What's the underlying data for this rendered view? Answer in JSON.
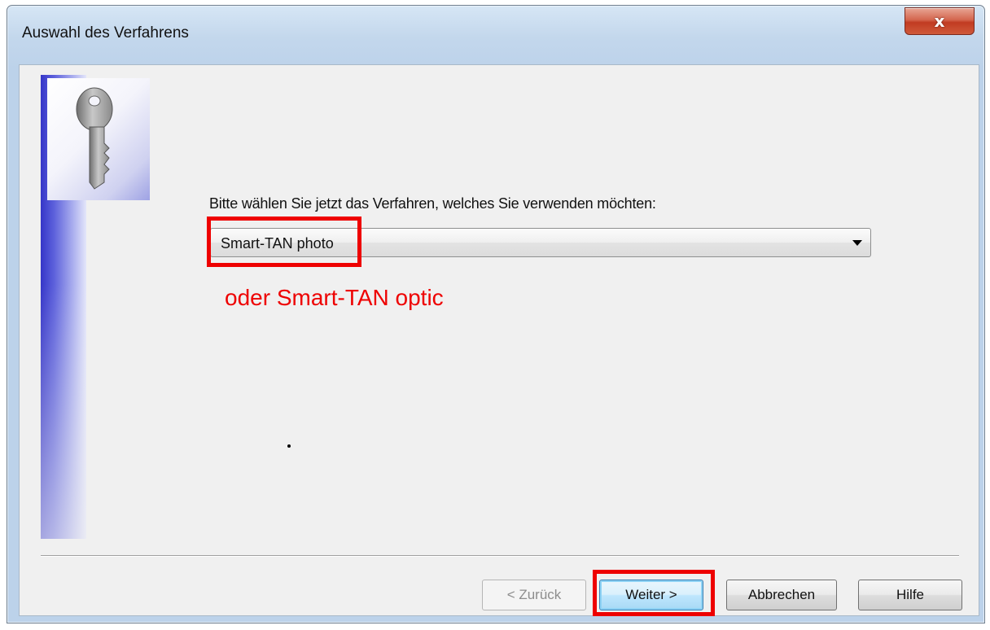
{
  "window": {
    "title": "Auswahl des Verfahrens",
    "close_label": "x"
  },
  "content": {
    "prompt": "Bitte wählen Sie jetzt das Verfahren, welches Sie verwenden möchten:",
    "method_select": {
      "selected": "Smart-TAN photo"
    },
    "annotation": "oder Smart-TAN optic"
  },
  "buttons": {
    "back": "< Zurück",
    "next": "Weiter >",
    "cancel": "Abbrechen",
    "help": "Hilfe"
  },
  "colors": {
    "annotation": "#ee0000",
    "side_band": "#3a3ccc",
    "dialog_background": "#f0f0f0"
  },
  "icons": [
    "key-icon",
    "close-icon",
    "chevron-down-icon"
  ]
}
